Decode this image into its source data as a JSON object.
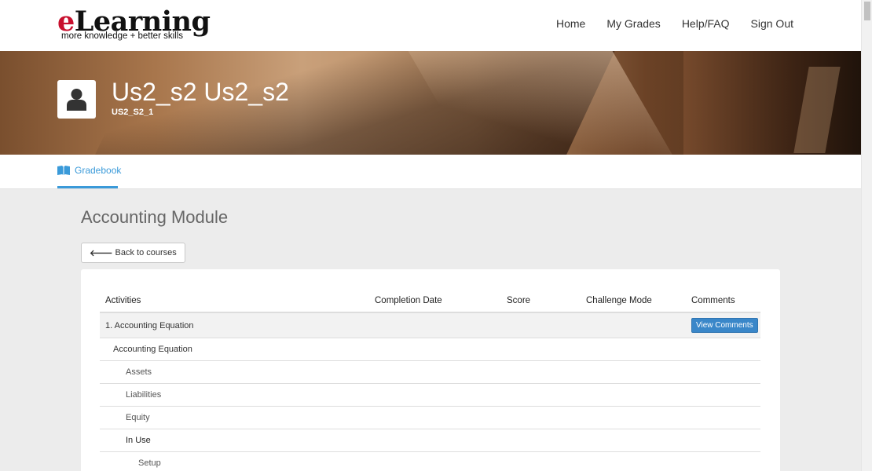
{
  "brand": {
    "name_first": "e",
    "name_rest": "Learning",
    "tagline": "more knowledge + better skills",
    "accent_color": "#c8102e"
  },
  "nav": {
    "items": [
      {
        "label": "Home"
      },
      {
        "label": "My Grades"
      },
      {
        "label": "Help/FAQ"
      },
      {
        "label": "Sign Out"
      }
    ]
  },
  "profile": {
    "name": "Us2_s2 Us2_s2",
    "user_id": "US2_S2_1",
    "avatar_icon": "user-icon"
  },
  "tabs": [
    {
      "label": "Gradebook",
      "icon": "book-open-icon",
      "active": true,
      "color": "#3a9ad9"
    }
  ],
  "main": {
    "course_title": "Accounting Module",
    "back_label": "Back to courses",
    "table": {
      "columns": [
        "Activities",
        "Completion Date",
        "Score",
        "Challenge Mode",
        "Comments"
      ],
      "rows": [
        {
          "label": "1. Accounting Equation",
          "level": 0,
          "comment_button": "View Comments"
        },
        {
          "label": "Accounting Equation",
          "level": 1
        },
        {
          "label": "Assets",
          "level": 2
        },
        {
          "label": "Liabilities",
          "level": 2
        },
        {
          "label": "Equity",
          "level": 2
        },
        {
          "label": "In Use",
          "level": 2,
          "emphasis": true
        },
        {
          "label": "Setup",
          "level": 3
        }
      ]
    },
    "button_color": "#3a87c9"
  }
}
